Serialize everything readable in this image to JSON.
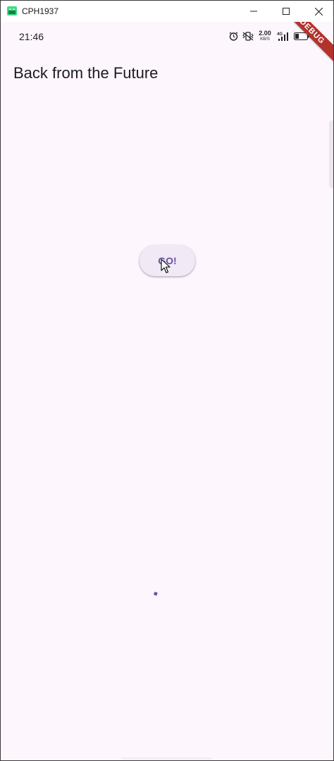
{
  "window": {
    "title": "CPH1937",
    "controls": {
      "minimize": "minimize-icon",
      "maximize": "maximize-icon",
      "close": "close-icon"
    }
  },
  "status_bar": {
    "time": "21:46",
    "net_speed_value": "2.00",
    "net_speed_unit": "KB/S",
    "network_type": "4G",
    "icons": [
      "alarm-icon",
      "vibrate-icon",
      "net-speed",
      "signal-icon",
      "battery-icon"
    ]
  },
  "debug_banner": "DEBUG",
  "app_bar": {
    "title": "Back from the Future"
  },
  "main": {
    "go_button_label": "GO!"
  },
  "colors": {
    "background": "#fdf7fd",
    "button_bg": "#f1e9f6",
    "button_text": "#6750a4",
    "debug_banner": "#b3322b",
    "progress": "#6750a4"
  }
}
